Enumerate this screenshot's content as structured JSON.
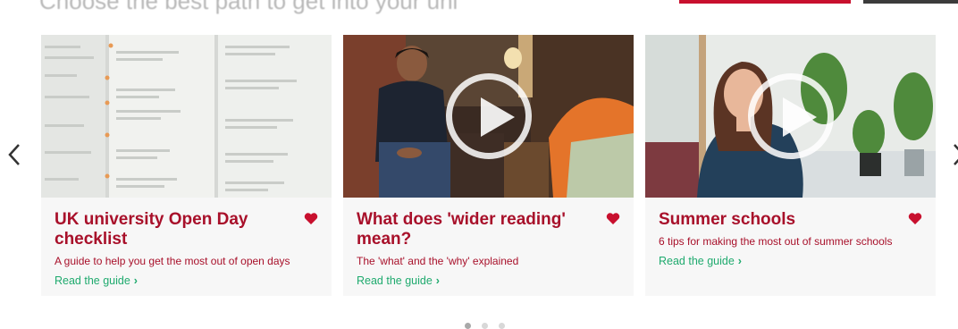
{
  "header": {
    "faded_title": "Choose the best path to get into your uni"
  },
  "carousel": {
    "cards": [
      {
        "title": "UK university Open Day checklist",
        "description": "A guide to help you get the most out of open days",
        "link": "Read the guide",
        "has_video": false
      },
      {
        "title": "What does 'wider reading' mean?",
        "description": "The 'what' and the 'why' explained",
        "link": "Read the guide",
        "has_video": true
      },
      {
        "title": "Summer schools",
        "description": "6 tips for making the most out of summer schools",
        "link": "Read the guide",
        "has_video": true
      }
    ],
    "pagination": {
      "count": 3,
      "active": 1
    }
  },
  "icons": {
    "prev": "chevron-left-icon",
    "next": "chevron-right-icon",
    "favorite": "heart-icon",
    "play": "play-icon"
  },
  "colors": {
    "brand_red": "#a8102a",
    "link_green": "#1faa6e",
    "card_bg": "#f7f7f7"
  }
}
